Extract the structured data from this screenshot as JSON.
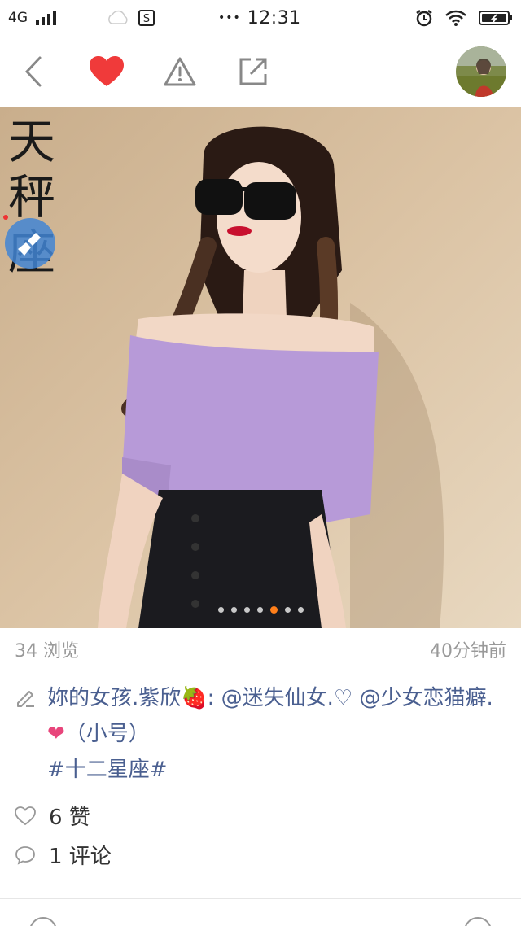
{
  "status_bar": {
    "network": "4G",
    "time": "12:31",
    "more": "•••"
  },
  "toolbar": {
    "icons": [
      "back-icon",
      "heart-icon",
      "warning-icon",
      "share-icon",
      "avatar"
    ],
    "accent_color": "#f03a3a"
  },
  "photo": {
    "overlay_text": [
      "天",
      "秤",
      "座"
    ],
    "carousel_count": 7,
    "carousel_active_index": 4
  },
  "meta": {
    "views": "34 浏览",
    "time_ago": "40分钟前"
  },
  "caption": {
    "author": "妳的女孩.紫欣",
    "author_emoji": "🍓",
    "colon": ": ",
    "mention1": "@迷失仙女.♡",
    "mention2": "@少女恋猫癖.",
    "heart_emoji": "❤",
    "suffix": "（小号）",
    "tag": "#十二星座#"
  },
  "stats": {
    "likes": "6 赞",
    "comments": "1 评论"
  },
  "colors": {
    "link": "#4a5f90",
    "muted": "#999999",
    "carousel_active": "#ff7f1a"
  }
}
